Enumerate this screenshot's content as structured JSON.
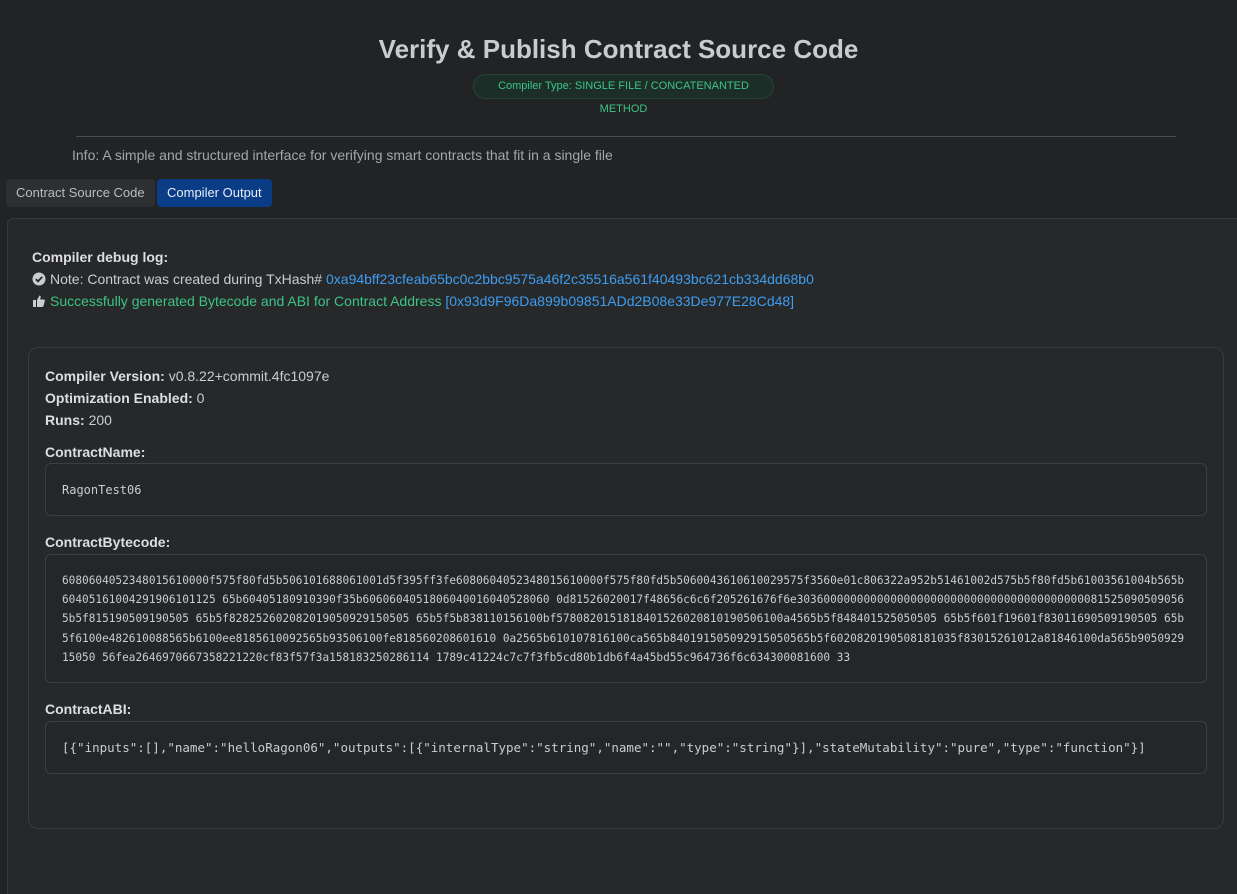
{
  "header": {
    "title": "Verify & Publish Contract Source Code",
    "compiler_type": "Compiler Type: SINGLE FILE / CONCATENANTED METHOD",
    "info": "Info: A simple and structured interface for verifying smart contracts that fit in a single file"
  },
  "tabs": [
    {
      "label": "Contract Source Code",
      "active": false
    },
    {
      "label": "Compiler Output",
      "active": true
    }
  ],
  "debug_log": {
    "heading": "Compiler debug log:",
    "note_prefix": "Note: Contract was created during TxHash#",
    "tx_hash": "0xa94bff23cfeab65bc0c2bbc9575a46f2c35516a561f40493bc621cb334dd68b0",
    "success_text": "Successfully generated Bytecode and ABI for Contract Address",
    "contract_address": "[0x93d9F96Da899b09851ADd2B08e33De977E28Cd48]"
  },
  "compiler": {
    "version_label": "Compiler Version:",
    "version_value": "v0.8.22+commit.4fc1097e",
    "optimization_label": "Optimization Enabled:",
    "optimization_value": "0",
    "runs_label": "Runs:",
    "runs_value": "200"
  },
  "contract": {
    "name_label": "ContractName:",
    "name_value": "RagonTest06",
    "bytecode_label": "ContractBytecode:",
    "bytecode_value": "6080604052348015610000f575f80fd5b506101688061001d5f395ff3fe6080604052348015610000f575f80fd5b5060043610610029575f3560e01c806322a952b51461002d575b5f80fd5b61003561004b565b60405161004291906101125 65b60405180910390f35b6060604051806040016040528060 0d81526020017f48656c6c6f205261676f6e3036000000000000000000000000000000000000000081525090509056 5b5f815190509190505 65b5f828252602082019050929150505 65b5f5b838110156100bf5780820151818401526020810190506100a4565b5f848401525050505 65b5f601f19601f83011690509190505 65b5f6100e482610088565b6100ee8185610092565b93506100fe818560208601610 0a2565b610107816100ca565b840191505092915050565b5f6020820190508181035f83015261012a81846100da565b905092915050 56fea2646970667358221220cf83f57f3a158183250286114 1789c41224c7c7f3fb5cd80b1db6f4a45bd55c964736f6c634300081600 33",
    "abi_label": "ContractABI:",
    "abi_value": "[{\"inputs\":[],\"name\":\"helloRagon06\",\"outputs\":[{\"internalType\":\"string\",\"name\":\"\",\"type\":\"string\"}],\"stateMutability\":\"pure\",\"type\":\"function\"}]"
  },
  "colors": {
    "accent_blue": "#0a3d86",
    "link_blue": "#3d9df0",
    "success_green": "#3cc487",
    "background": "#222325"
  },
  "icons": {
    "note": "check-circle-icon",
    "success": "thumbs-up-icon"
  }
}
